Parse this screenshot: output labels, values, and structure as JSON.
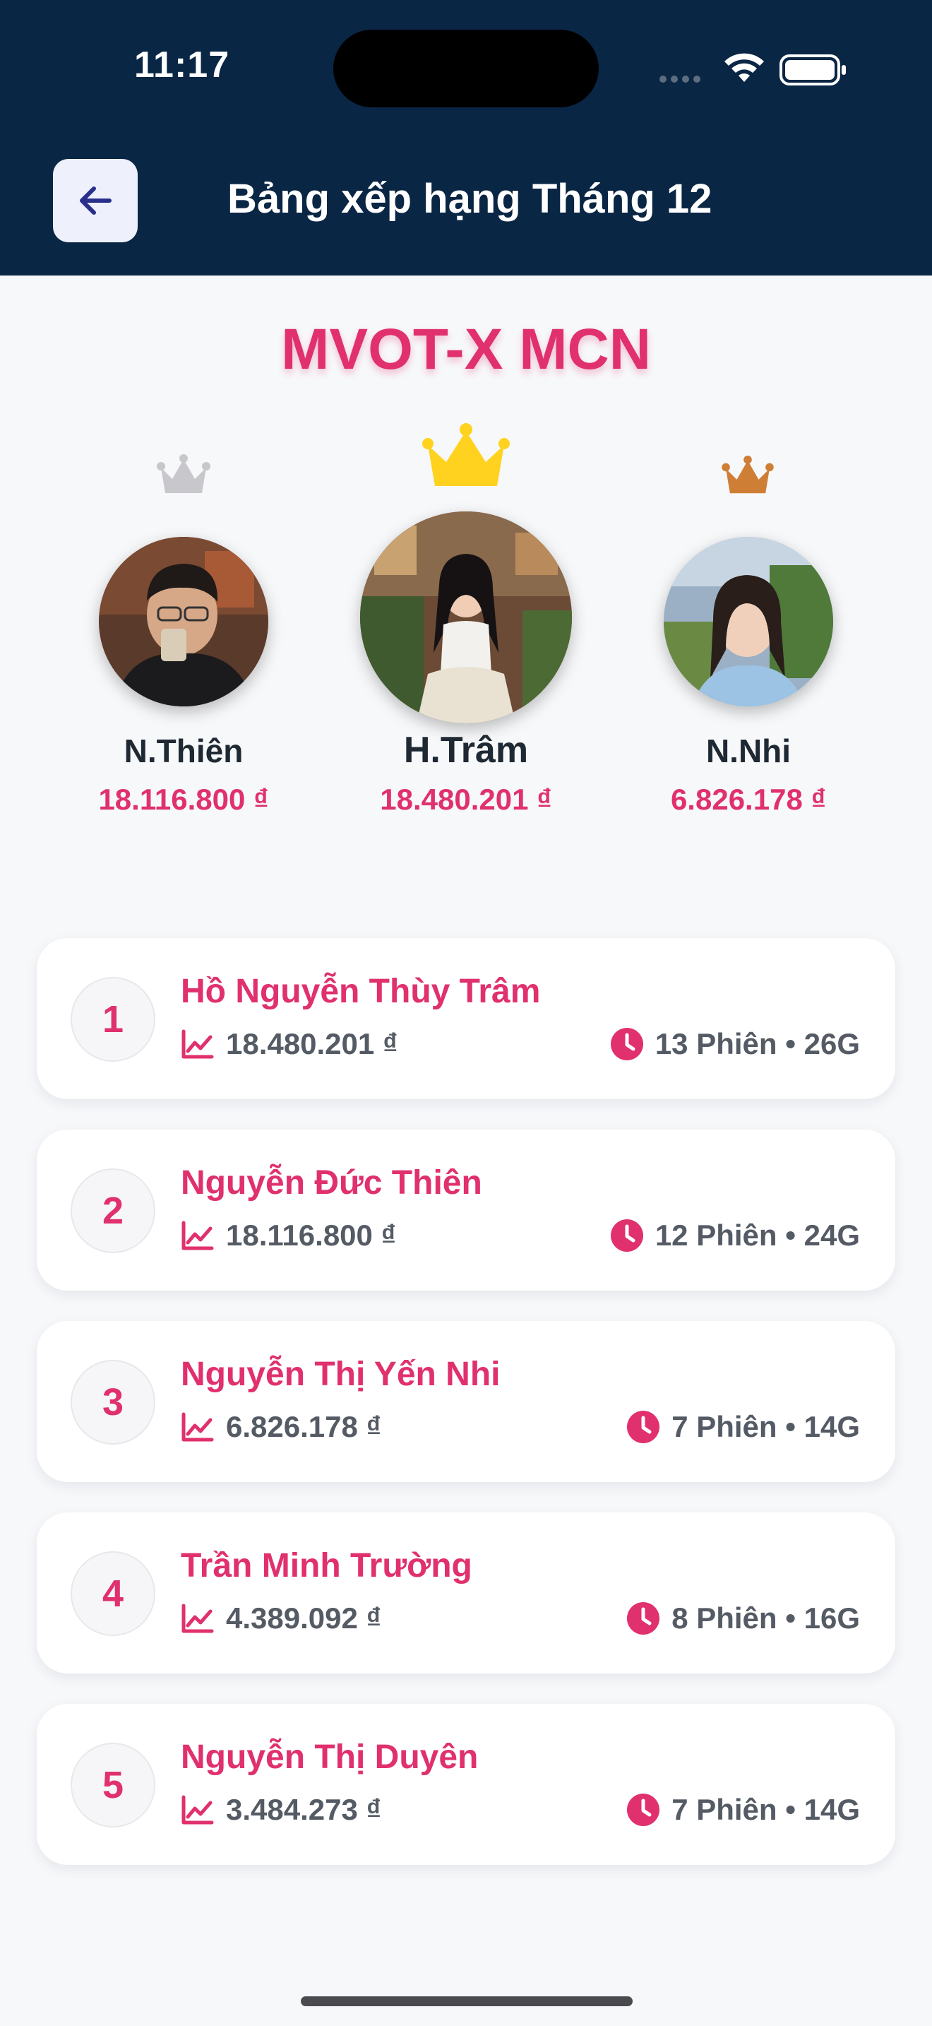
{
  "status_bar": {
    "time": "11:17"
  },
  "header": {
    "title": "Bảng xếp hạng Tháng 12"
  },
  "brand": "MVOT-X MCN",
  "podium": [
    {
      "place": 2,
      "name": "N.Thiên",
      "amount": "18.116.800 ₫",
      "crown_color": "#c8c8cc"
    },
    {
      "place": 1,
      "name": "H.Trâm",
      "amount": "18.480.201 ₫",
      "crown_color": "#ffd21f"
    },
    {
      "place": 3,
      "name": "N.Nhi",
      "amount": "6.826.178 ₫",
      "crown_color": "#cf7e35"
    }
  ],
  "ranking": [
    {
      "rank": "1",
      "name": "Hồ Nguyễn Thùy Trâm",
      "revenue": "18.480.201 ₫",
      "sessions": "13 Phiên • 26G"
    },
    {
      "rank": "2",
      "name": "Nguyễn Đức Thiên",
      "revenue": "18.116.800 ₫",
      "sessions": "12 Phiên • 24G"
    },
    {
      "rank": "3",
      "name": "Nguyễn Thị Yến Nhi",
      "revenue": "6.826.178 ₫",
      "sessions": "7 Phiên • 14G"
    },
    {
      "rank": "4",
      "name": "Trần Minh Trường",
      "revenue": "4.389.092 ₫",
      "sessions": "8 Phiên • 16G"
    },
    {
      "rank": "5",
      "name": "Nguyễn Thị Duyên",
      "revenue": "3.484.273 ₫",
      "sessions": "7 Phiên • 14G"
    }
  ],
  "icons": {
    "back": "arrow-left-icon",
    "revenue": "trend-chart-icon",
    "sessions": "clock-icon",
    "crown": "crown-icon"
  },
  "colors": {
    "header_bg": "#0a2645",
    "accent": "#e0306e",
    "page_bg": "#f7f8fa"
  }
}
